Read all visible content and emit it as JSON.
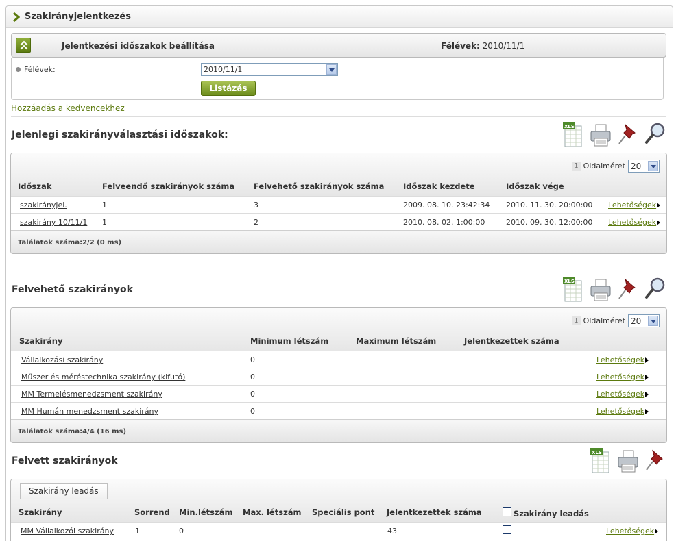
{
  "page": {
    "title": "Szakirányjelentkezés"
  },
  "settings": {
    "title": "Jelentkezési időszakok beállítása",
    "semester_label": "Félévek:",
    "semester_value": "2010/11/1",
    "field_label": "Félévek:",
    "select_value": "2010/11/1",
    "list_button": "Listázás"
  },
  "favorites_link": "Hozzáadás a kedvencekhez",
  "periods": {
    "title": "Jelenlegi szakirányválasztási időszakok:",
    "page_number": "1",
    "page_size_label": "Oldalméret",
    "page_size": "20",
    "columns": [
      "Időszak",
      "Felveendő szakirányok száma",
      "Felvehető szakirányok száma",
      "Időszak kezdete",
      "Időszak vége"
    ],
    "rows": [
      {
        "name": "szakirányjel.",
        "required": "1",
        "available": "3",
        "start": "2009. 08. 10. 23:42:34",
        "end": "2010. 11. 30. 20:00:00",
        "options": "Lehetőségek"
      },
      {
        "name": "szakirány 10/11/1",
        "required": "1",
        "available": "2",
        "start": "2010. 08. 02. 1:00:00",
        "end": "2010. 09. 30. 12:00:00",
        "options": "Lehetőségek"
      }
    ],
    "footer": "Találatok száma:2/2 (0 ms)"
  },
  "available": {
    "title": "Felvehető szakirányok",
    "page_number": "1",
    "page_size_label": "Oldalméret",
    "page_size": "20",
    "columns": [
      "Szakirány",
      "Minimum létszám",
      "Maximum létszám",
      "Jelentkezettek száma"
    ],
    "rows": [
      {
        "name": "Vállalkozási szakirány",
        "min": "0",
        "options": "Lehetőségek"
      },
      {
        "name": "Műszer és méréstechnika szakirány (kifutó)",
        "min": "0",
        "options": "Lehetőségek"
      },
      {
        "name": "MM Termelésmenedzsment szakirány",
        "min": "0",
        "options": "Lehetőségek"
      },
      {
        "name": "MM Humán menedzsment szakirány",
        "min": "0",
        "options": "Lehetőségek"
      }
    ],
    "footer": "Találatok száma:4/4 (16 ms)"
  },
  "taken": {
    "title": "Felvett szakirányok",
    "drop_button": "Szakirány leadás",
    "columns": [
      "Szakirány",
      "Sorrend",
      "Min.létszám",
      "Max. létszám",
      "Speciális pont",
      "Jelentkezettek száma",
      "Szakirány leadás"
    ],
    "rows": [
      {
        "name": "MM Vállalkozói szakirány",
        "order": "1",
        "min": "0",
        "max": "",
        "special": "",
        "applicants": "43",
        "options": "Lehetőségek"
      }
    ]
  },
  "icons": {
    "export": "xls-export-icon",
    "print": "printer-icon",
    "pin": "pushpin-icon",
    "search": "magnifier-icon"
  },
  "colors": {
    "accent": "#5c7a0e",
    "button_green": "#7e9c2a"
  }
}
